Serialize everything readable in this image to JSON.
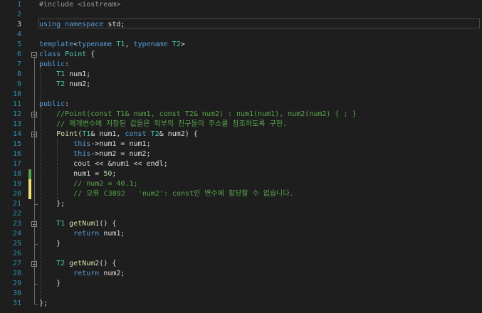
{
  "editor": {
    "current_line": 3,
    "colors": {
      "background": "#1e1e1e",
      "line_number": "#2b91af",
      "keyword": "#569cd6",
      "type": "#4ec9b0",
      "comment": "#57a64a",
      "text": "#dcdcdc",
      "saved_change": "#57a64a",
      "unsaved_change": "#efe07a"
    },
    "line_numbers": [
      "1",
      "2",
      "3",
      "4",
      "5",
      "6",
      "7",
      "8",
      "9",
      "10",
      "11",
      "12",
      "13",
      "14",
      "15",
      "16",
      "17",
      "18",
      "19",
      "20",
      "21",
      "22",
      "23",
      "24",
      "25",
      "26",
      "27",
      "28",
      "29",
      "30",
      "31"
    ],
    "lines": [
      [
        [
          "pp",
          "#include <iostream>"
        ]
      ],
      [],
      [
        [
          "kw",
          "using"
        ],
        [
          "tx",
          " "
        ],
        [
          "kw",
          "namespace"
        ],
        [
          "tx",
          " std;"
        ]
      ],
      [],
      [
        [
          "kw",
          "template"
        ],
        [
          "tx",
          "<"
        ],
        [
          "kw",
          "typename"
        ],
        [
          "tx",
          " "
        ],
        [
          "ty",
          "T1"
        ],
        [
          "tx",
          ", "
        ],
        [
          "kw",
          "typename"
        ],
        [
          "tx",
          " "
        ],
        [
          "ty",
          "T2"
        ],
        [
          "tx",
          ">"
        ]
      ],
      [
        [
          "kw",
          "class"
        ],
        [
          "tx",
          " "
        ],
        [
          "ty",
          "Point"
        ],
        [
          "tx",
          " {"
        ]
      ],
      [
        [
          "kw",
          "public"
        ],
        [
          "tx",
          ":"
        ]
      ],
      [
        [
          "tx",
          "    "
        ],
        [
          "ty",
          "T1"
        ],
        [
          "tx",
          " num1;"
        ]
      ],
      [
        [
          "tx",
          "    "
        ],
        [
          "ty",
          "T2"
        ],
        [
          "tx",
          " num2;"
        ]
      ],
      [],
      [
        [
          "kw",
          "public"
        ],
        [
          "tx",
          ":"
        ]
      ],
      [
        [
          "tx",
          "    "
        ],
        [
          "cm",
          "//Point(const T1& num1, const T2& num2) : num1(num1), num2(num2) { ; }"
        ]
      ],
      [
        [
          "tx",
          "    "
        ],
        [
          "cm",
          "// 매개변수에 저장된 값들은 외부의 친구들이 주소를 참조하도록 구현."
        ]
      ],
      [
        [
          "tx",
          "    "
        ],
        [
          "fn",
          "Point"
        ],
        [
          "tx",
          "("
        ],
        [
          "ty",
          "T1"
        ],
        [
          "tx",
          "& num1, "
        ],
        [
          "kw",
          "const"
        ],
        [
          "tx",
          " "
        ],
        [
          "ty",
          "T2"
        ],
        [
          "tx",
          "& num2) {"
        ]
      ],
      [
        [
          "tx",
          "        "
        ],
        [
          "kw",
          "this"
        ],
        [
          "tx",
          "->num1 = num1;"
        ]
      ],
      [
        [
          "tx",
          "        "
        ],
        [
          "kw",
          "this"
        ],
        [
          "tx",
          "->num2 = num2;"
        ]
      ],
      [
        [
          "tx",
          "        cout << &num1 << endl;"
        ]
      ],
      [
        [
          "tx",
          "        num1 = "
        ],
        [
          "nm",
          "50"
        ],
        [
          "tx",
          ";"
        ]
      ],
      [
        [
          "tx",
          "        "
        ],
        [
          "cm",
          "// num2 = 40.1;"
        ]
      ],
      [
        [
          "tx",
          "        "
        ],
        [
          "cm",
          "// 오류 C3892   'num2': const인 변수에 할당할 수 없습니다."
        ]
      ],
      [
        [
          "tx",
          "    };"
        ]
      ],
      [],
      [
        [
          "tx",
          "    "
        ],
        [
          "ty",
          "T1"
        ],
        [
          "tx",
          " "
        ],
        [
          "fn",
          "getNum1"
        ],
        [
          "tx",
          "() {"
        ]
      ],
      [
        [
          "tx",
          "        "
        ],
        [
          "kw",
          "return"
        ],
        [
          "tx",
          " num1;"
        ]
      ],
      [
        [
          "tx",
          "    }"
        ]
      ],
      [],
      [
        [
          "tx",
          "    "
        ],
        [
          "ty",
          "T2"
        ],
        [
          "tx",
          " "
        ],
        [
          "fn",
          "getNum2"
        ],
        [
          "tx",
          "() {"
        ]
      ],
      [
        [
          "tx",
          "        "
        ],
        [
          "kw",
          "return"
        ],
        [
          "tx",
          " num2;"
        ]
      ],
      [
        [
          "tx",
          "    }"
        ]
      ],
      [],
      [
        [
          "tx",
          "};"
        ]
      ]
    ],
    "fold_markers": [
      6,
      12,
      14,
      23,
      27
    ],
    "change_markers": [
      {
        "line": 18,
        "state": "saved"
      },
      {
        "line": 19,
        "state": "unsaved"
      },
      {
        "line": 20,
        "state": "unsaved"
      }
    ]
  }
}
